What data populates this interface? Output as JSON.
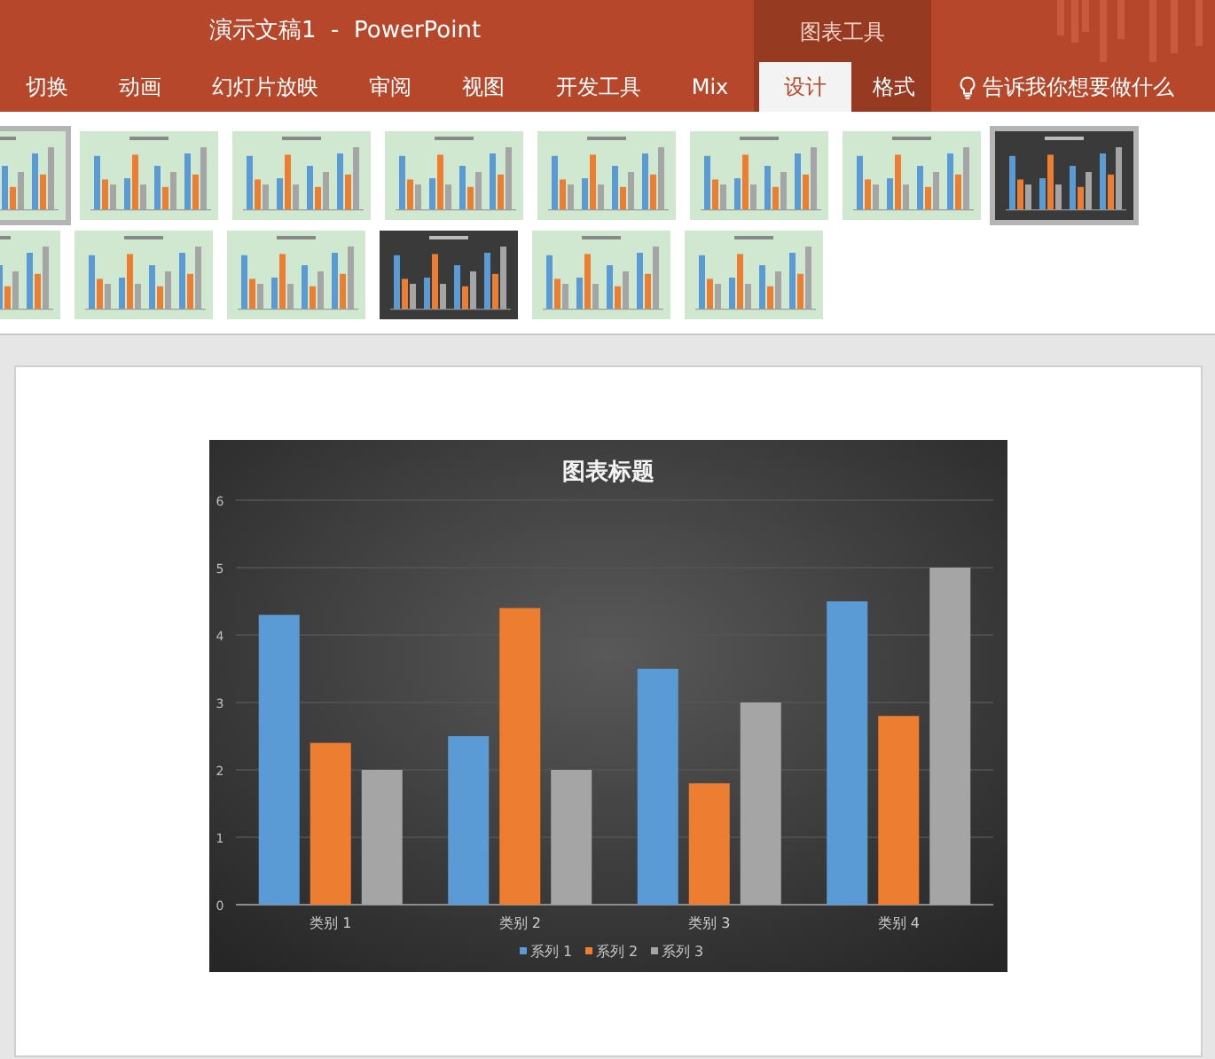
{
  "window": {
    "title": "演示文稿1  -  PowerPoint"
  },
  "context_tab_group": {
    "label": "图表工具"
  },
  "tabs": [
    {
      "label": "切换",
      "selected": false,
      "kind": "normal"
    },
    {
      "label": "动画",
      "selected": false,
      "kind": "normal"
    },
    {
      "label": "幻灯片放映",
      "selected": false,
      "kind": "normal"
    },
    {
      "label": "审阅",
      "selected": false,
      "kind": "normal"
    },
    {
      "label": "视图",
      "selected": false,
      "kind": "normal"
    },
    {
      "label": "开发工具",
      "selected": false,
      "kind": "normal"
    },
    {
      "label": "Mix",
      "selected": false,
      "kind": "normal"
    },
    {
      "label": "设计",
      "selected": true,
      "kind": "context"
    },
    {
      "label": "格式",
      "selected": false,
      "kind": "context"
    }
  ],
  "tell_me": {
    "label": "告诉我你想要做什么"
  },
  "chart_styles": {
    "rows": [
      [
        {
          "kind": "light",
          "selected": true
        },
        {
          "kind": "light",
          "selected": false
        },
        {
          "kind": "light",
          "selected": false
        },
        {
          "kind": "light",
          "selected": false
        },
        {
          "kind": "light",
          "selected": false
        },
        {
          "kind": "light",
          "selected": false
        },
        {
          "kind": "light",
          "selected": false
        },
        {
          "kind": "dark",
          "selected": true
        }
      ],
      [
        {
          "kind": "light",
          "selected": false
        },
        {
          "kind": "light",
          "selected": false
        },
        {
          "kind": "light",
          "selected": false
        },
        {
          "kind": "dark",
          "selected": false
        },
        {
          "kind": "light",
          "selected": false
        },
        {
          "kind": "light",
          "selected": false
        }
      ]
    ]
  },
  "chart": {
    "chart_data": {
      "type": "bar",
      "title": "图表标题",
      "categories": [
        "类别 1",
        "类别 2",
        "类别 3",
        "类别 4"
      ],
      "series": [
        {
          "name": "系列 1",
          "color": "#5b9bd5",
          "values": [
            4.3,
            2.5,
            3.5,
            4.5
          ]
        },
        {
          "name": "系列 2",
          "color": "#ed7d31",
          "values": [
            2.4,
            4.4,
            1.8,
            2.8
          ]
        },
        {
          "name": "系列 3",
          "color": "#a5a5a5",
          "values": [
            2,
            2,
            3,
            5
          ]
        }
      ],
      "ylim": [
        0,
        6
      ],
      "yticks": [
        0,
        1,
        2,
        3,
        4,
        5,
        6
      ],
      "grid": true,
      "legend": true
    }
  }
}
